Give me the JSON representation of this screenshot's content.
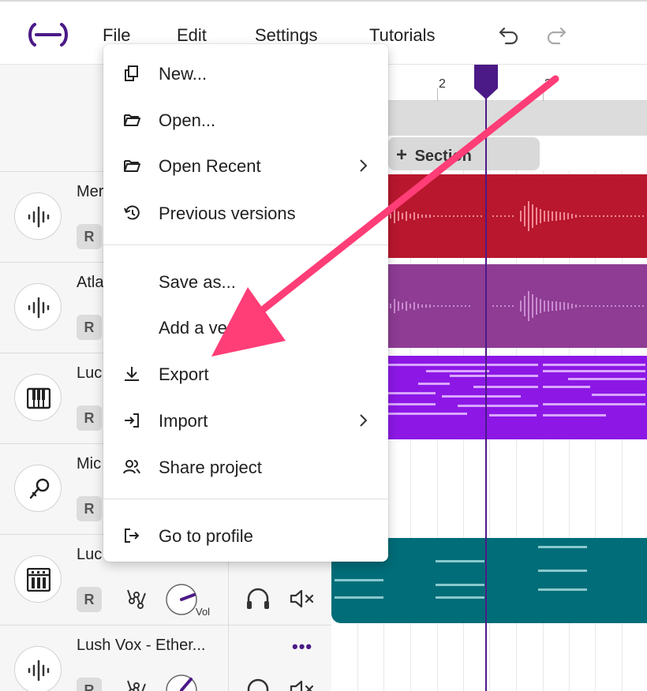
{
  "menubar": {
    "items": [
      {
        "label": "File"
      },
      {
        "label": "Edit"
      },
      {
        "label": "Settings"
      },
      {
        "label": "Tutorials"
      }
    ],
    "logo_icon": "soundtrap-logo-icon",
    "undo_icon": "undo-icon",
    "redo_icon": "redo-icon",
    "brand_color": "#4b1a86"
  },
  "timeline": {
    "ruler_numbers": [
      "2",
      "3"
    ],
    "add_section_label": "Section",
    "playhead_color": "#4b1a86",
    "clip_colors": [
      "#b8172e",
      "#8e3c94",
      "#8d18e6",
      "#006d78"
    ]
  },
  "tracks": [
    {
      "name": "Mer",
      "record": "R",
      "icon": "waveform-icon"
    },
    {
      "name": "Atla",
      "record": "R",
      "icon": "waveform-icon"
    },
    {
      "name": "Luc",
      "record": "R",
      "icon": "piano-icon"
    },
    {
      "name": "Mic",
      "record": "R",
      "icon": "microphone-icon"
    },
    {
      "name": "Luc",
      "record": "R",
      "icon": "drum-machine-icon",
      "vol_label": "Vol"
    },
    {
      "name": "Lush Vox - Ether...",
      "record": "R",
      "icon": "waveform-icon",
      "more": "•••"
    }
  ],
  "file_menu": {
    "items": [
      {
        "label": "New...",
        "icon": "copy-icon"
      },
      {
        "label": "Open...",
        "icon": "folder-open-icon"
      },
      {
        "label": "Open Recent",
        "icon": "folder-open-icon",
        "submenu": true
      },
      {
        "label": "Previous versions",
        "icon": "history-icon"
      },
      {
        "label": "Save as...",
        "icon": ""
      },
      {
        "label": "Add a ve",
        "icon": ""
      },
      {
        "label": "Export",
        "icon": "download-icon"
      },
      {
        "label": "Import",
        "icon": "import-icon",
        "submenu": true
      },
      {
        "label": "Share project",
        "icon": "people-icon"
      },
      {
        "label": "Go to profile",
        "icon": "logout-icon"
      }
    ]
  },
  "annotation": {
    "arrow_color": "#ff3d77",
    "points_to": "Export"
  }
}
